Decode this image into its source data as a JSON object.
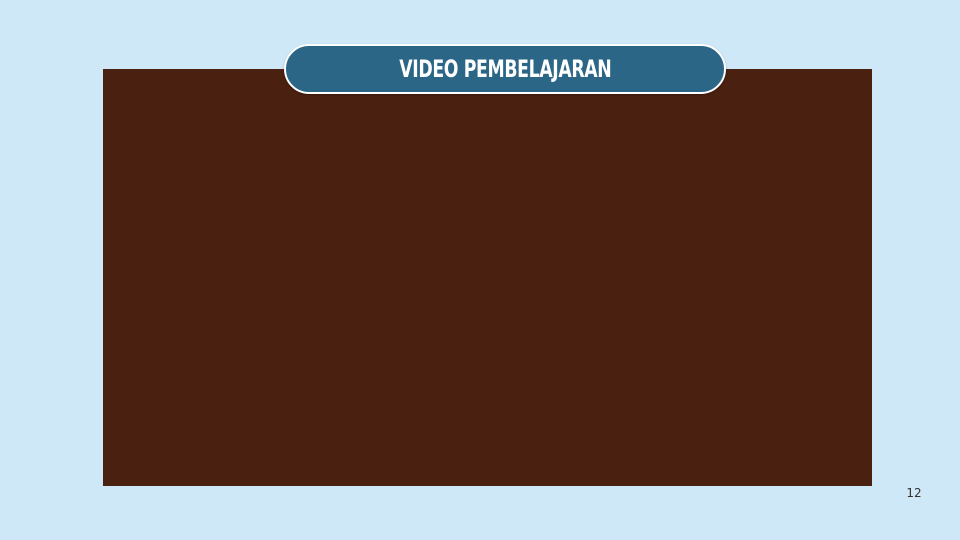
{
  "slide": {
    "title": "VIDEO PEMBELAJARAN",
    "page_number": "12"
  },
  "colors": {
    "background": "#cfe8f7",
    "video_panel": "#4a2010",
    "title_pill": "#2b6687",
    "title_text": "#ffffff",
    "page_number": "#333333"
  }
}
